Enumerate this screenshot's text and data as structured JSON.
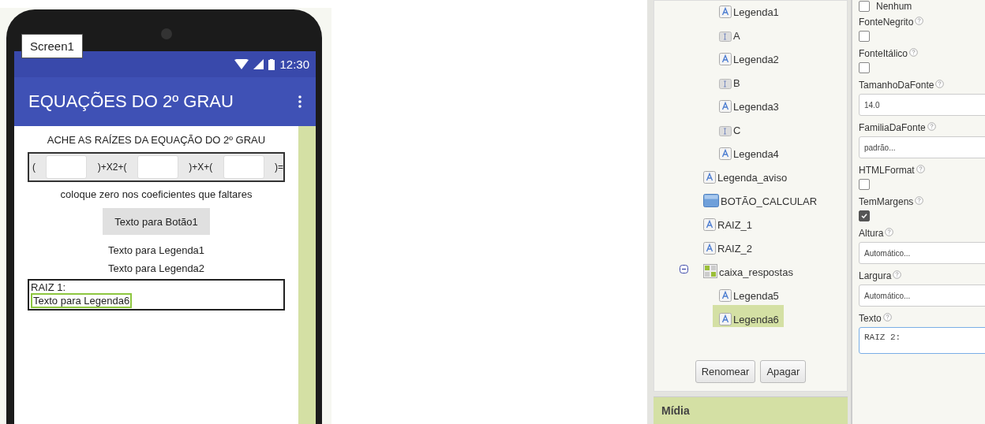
{
  "phone": {
    "screen_tab": "Screen1",
    "status_time": "12:30",
    "app_title": "EQUAÇÕES DO 2º GRAU",
    "heading": "ACHE AS RAÍZES DA EQUAÇÃO DO 2º GRAU",
    "equation": [
      {
        "kind": "text",
        "text": "("
      },
      {
        "kind": "input"
      },
      {
        "kind": "text",
        "text": ")+X2+("
      },
      {
        "kind": "input"
      },
      {
        "kind": "text",
        "text": ")+X+("
      },
      {
        "kind": "input"
      },
      {
        "kind": "text",
        "text": ")="
      }
    ],
    "hint": "coloque zero nos coeficientes que faltares",
    "button": "Texto para Botão1",
    "labels": [
      "Texto para Legenda1",
      "Texto para Legenda2"
    ],
    "answer_box": {
      "title": "RAIZ 1:",
      "label": "Texto para Legenda6",
      "selected": true
    }
  },
  "tree": {
    "partial_children": [
      {
        "label": "Legenda1",
        "kind": "label",
        "selected": false
      },
      {
        "label": "A",
        "kind": "textbox",
        "selected": false
      },
      {
        "label": "Legenda2",
        "kind": "label",
        "selected": false
      },
      {
        "label": "B",
        "kind": "textbox",
        "selected": false
      },
      {
        "label": "Legenda3",
        "kind": "label",
        "selected": false
      },
      {
        "label": "C",
        "kind": "textbox",
        "selected": false
      },
      {
        "label": "Legenda4",
        "kind": "label",
        "selected": false
      }
    ],
    "items": [
      {
        "label": "Legenda_aviso",
        "kind": "label",
        "selected": false
      },
      {
        "label": "BOTÃO_CALCULAR",
        "kind": "button",
        "selected": false
      },
      {
        "label": "RAIZ_1",
        "kind": "label",
        "selected": false
      },
      {
        "label": "RAIZ_2",
        "kind": "label",
        "selected": false
      },
      {
        "label": "caixa_respostas",
        "kind": "arrangement",
        "selected": false,
        "expanded": true,
        "children": [
          {
            "label": "Legenda5",
            "kind": "label",
            "selected": false
          },
          {
            "label": "Legenda6",
            "kind": "label",
            "selected": true
          }
        ]
      }
    ],
    "buttons": [
      "Renomear",
      "Apagar"
    ],
    "next_section": "Mídia"
  },
  "properties": {
    "top_option": {
      "label": "Nenhum",
      "checked": false
    },
    "items": [
      {
        "name": "FonteNegrito",
        "kind": "checkbox",
        "checked": false
      },
      {
        "name": "FonteItálico",
        "kind": "checkbox",
        "checked": false
      },
      {
        "name": "TamanhoDaFonte",
        "kind": "field",
        "value": "14.0"
      },
      {
        "name": "FamiliaDaFonte",
        "kind": "field",
        "value": "padrão..."
      },
      {
        "name": "HTMLFormat",
        "kind": "checkbox",
        "checked": false
      },
      {
        "name": "TemMargens",
        "kind": "checkbox",
        "checked": true
      },
      {
        "name": "Altura",
        "kind": "field",
        "value": "Automático..."
      },
      {
        "name": "Largura",
        "kind": "field",
        "value": "Automático..."
      },
      {
        "name": "Texto",
        "kind": "textarea",
        "value": "RAIZ 2:"
      }
    ]
  }
}
